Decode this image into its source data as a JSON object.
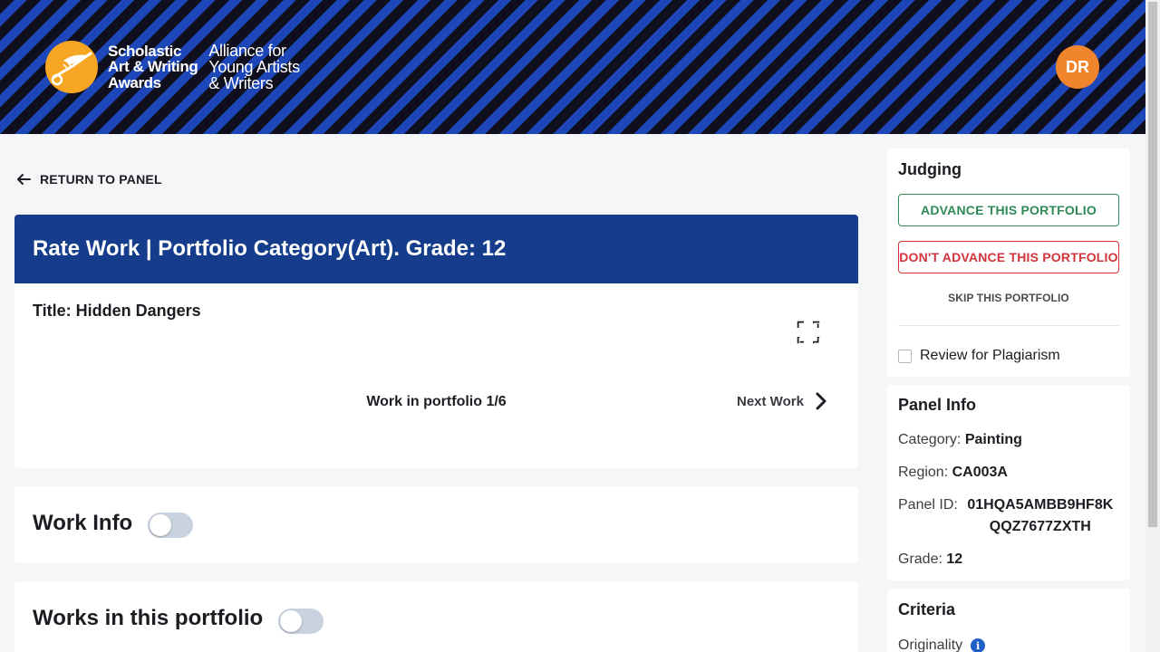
{
  "header": {
    "logo_lines": [
      "Scholastic",
      "Art & Writing",
      "Awards"
    ],
    "logo_sub_lines": [
      "Alliance for",
      "Young Artists",
      "& Writers"
    ],
    "avatar_initials": "DR"
  },
  "nav": {
    "return_label": "RETURN TO PANEL"
  },
  "rate_card": {
    "heading": "Rate Work | Portfolio Category(Art). Grade: 12",
    "work_title": "Title: Hidden Dangers",
    "portfolio_count": "Work in portfolio 1/6",
    "next_label": "Next Work"
  },
  "sections": {
    "work_info": "Work Info",
    "works_in_portfolio": "Works in this portfolio"
  },
  "judging": {
    "title": "Judging",
    "advance_label": "ADVANCE THIS PORTFOLIO",
    "dont_advance_label": "DON'T ADVANCE THIS PORTFOLIO",
    "skip_label": "SKIP THIS PORTFOLIO",
    "plagiarism_label": "Review for Plagiarism"
  },
  "panel_info": {
    "title": "Panel Info",
    "category_label": "Category:",
    "category_value": "Painting",
    "region_label": "Region:",
    "region_value": "CA003A",
    "panel_id_label": "Panel ID:",
    "panel_id_value": "01HQA5AMBB9HF8KQQZ7677ZXTH",
    "grade_label": "Grade:",
    "grade_value": "12"
  },
  "criteria": {
    "title": "Criteria",
    "first_item": "Originality"
  },
  "colors": {
    "header_blue": "#1d47b8",
    "header_dark": "#0f0f1e",
    "rate_head_blue": "#163d8c",
    "advance_green": "#2e8b57",
    "dont_advance_red": "#d1343a",
    "avatar_orange": "#f0852d",
    "logo_gold": "#f6a623"
  }
}
